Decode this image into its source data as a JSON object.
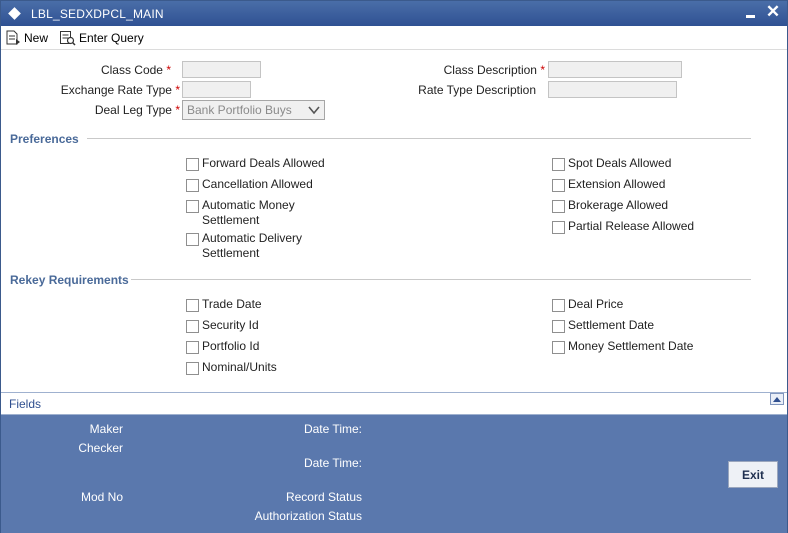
{
  "window": {
    "title": "LBL_SEDXDPCL_MAIN"
  },
  "toolbar": {
    "new_label": "New",
    "enter_query_label": "Enter Query"
  },
  "form": {
    "class_code_label": "Class Code",
    "class_code_value": "",
    "exchange_rate_type_label": "Exchange Rate Type",
    "exchange_rate_type_value": "",
    "deal_leg_type_label": "Deal Leg Type",
    "deal_leg_type_value": "Bank Portfolio Buys",
    "class_description_label": "Class Description",
    "class_description_value": "",
    "rate_type_description_label": "Rate Type Description",
    "rate_type_description_value": "",
    "required_marker": "*"
  },
  "preferences": {
    "title": "Preferences",
    "left": [
      {
        "label": "Forward Deals Allowed",
        "checked": false
      },
      {
        "label": "Cancellation Allowed",
        "checked": false
      },
      {
        "label": "Automatic Money",
        "label2": "Settlement",
        "checked": false
      },
      {
        "label": "Automatic Delivery",
        "label2": "Settlement",
        "checked": false
      }
    ],
    "right": [
      {
        "label": "Spot Deals Allowed",
        "checked": false
      },
      {
        "label": "Extension Allowed",
        "checked": false
      },
      {
        "label": "Brokerage Allowed",
        "checked": false
      },
      {
        "label": "Partial Release Allowed",
        "checked": false
      }
    ]
  },
  "rekey": {
    "title": "Rekey Requirements",
    "left": [
      {
        "label": "Trade Date",
        "checked": false
      },
      {
        "label": "Security Id",
        "checked": false
      },
      {
        "label": "Portfolio Id",
        "checked": false
      },
      {
        "label": "Nominal/Units",
        "checked": false
      }
    ],
    "right": [
      {
        "label": "Deal Price",
        "checked": false
      },
      {
        "label": "Settlement Date",
        "checked": false
      },
      {
        "label": "Money Settlement Date",
        "checked": false
      }
    ]
  },
  "fields_bar": {
    "label": "Fields"
  },
  "footer": {
    "maker_label": "Maker",
    "checker_label": "Checker",
    "mod_no_label": "Mod No",
    "date_time_label_1": "Date Time:",
    "date_time_label_2": "Date Time:",
    "record_status_label": "Record Status",
    "authorization_status_label": "Authorization Status",
    "exit_label": "Exit"
  },
  "colors": {
    "title_bar": "#2f5193",
    "footer": "#5a78ad",
    "section_title": "#4a6a99",
    "required": "#cc0000"
  },
  "icons": [
    "diamond-icon",
    "minimize-icon",
    "close-icon",
    "new-document-icon",
    "enter-query-icon",
    "chevron-down-icon",
    "collapse-up-icon"
  ]
}
